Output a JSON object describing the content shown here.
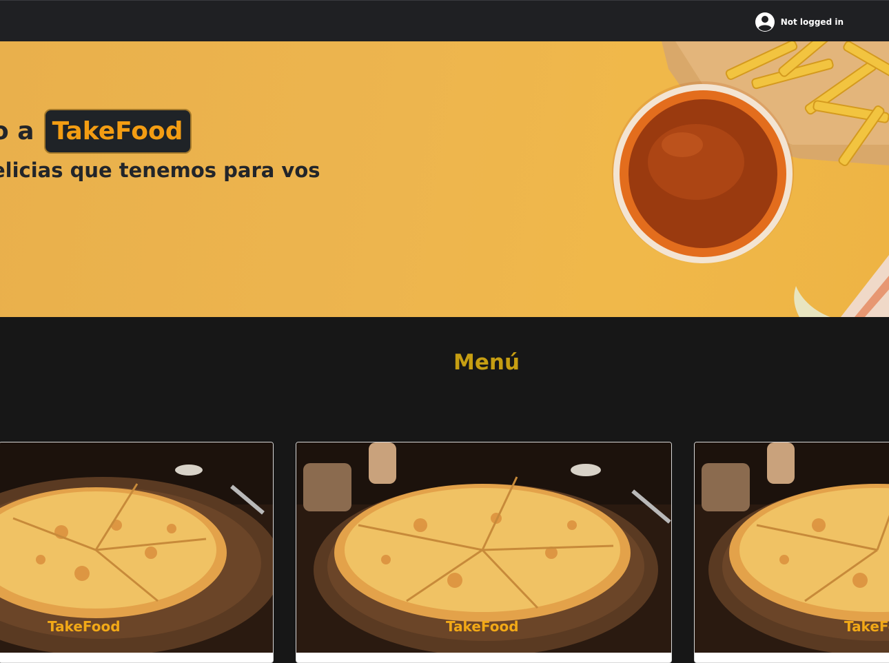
{
  "navbar": {
    "user_status": "Not logged in",
    "user_icon": "account-circle-icon"
  },
  "hero": {
    "line1_prefix": "o a",
    "brand": "TakeFood",
    "line2": "elicias que tenemos para vos"
  },
  "menu": {
    "title": "Menú",
    "cards": [
      {
        "brand": "TakeFood"
      },
      {
        "brand": "TakeFood"
      },
      {
        "brand": "TakeFo"
      }
    ]
  },
  "colors": {
    "navbar_bg": "#1f2023",
    "hero_bg": "#edb54e",
    "page_bg": "#171717",
    "accent_orange": "#f39d13",
    "menu_title": "#c69e12"
  }
}
